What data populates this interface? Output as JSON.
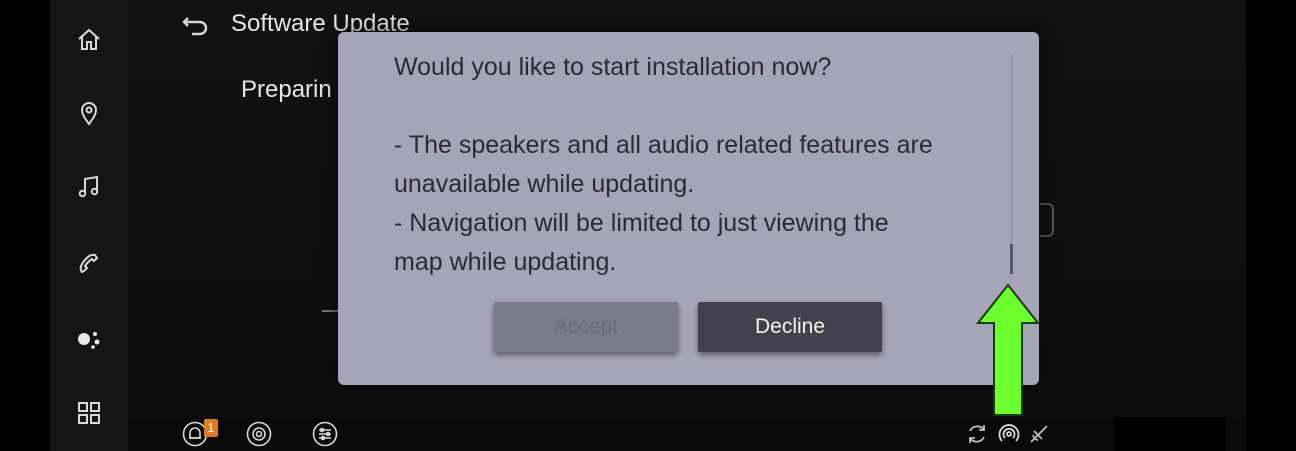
{
  "header": {
    "title": "Software Update"
  },
  "background": {
    "status_text": "Preparin"
  },
  "dialog": {
    "lines": [
      "Would you like to start installation now?",
      "",
      "- The speakers and all audio related features are",
      "unavailable while updating.",
      "- Navigation will be limited to just viewing the",
      "map while updating."
    ],
    "accept_label": "Accept",
    "decline_label": "Decline"
  },
  "statusbar": {
    "notification_count": "1"
  },
  "icons": {
    "rail": [
      "home-icon",
      "location-pin-icon",
      "music-icon",
      "phone-icon",
      "assistant-icon",
      "apps-grid-icon"
    ],
    "statusbar_left": [
      "bell-icon",
      "settings-icon",
      "equalizer-icon"
    ],
    "statusbar_right": [
      "sync-icon",
      "wireless-signal-icon",
      "satellite-off-icon"
    ]
  },
  "colors": {
    "dialog_bg": "#a6a5b7",
    "decline_bg": "#43424c",
    "accept_bg": "#7c7b8b",
    "badge": "#e07a1f",
    "arrow": "#6cff2e"
  }
}
